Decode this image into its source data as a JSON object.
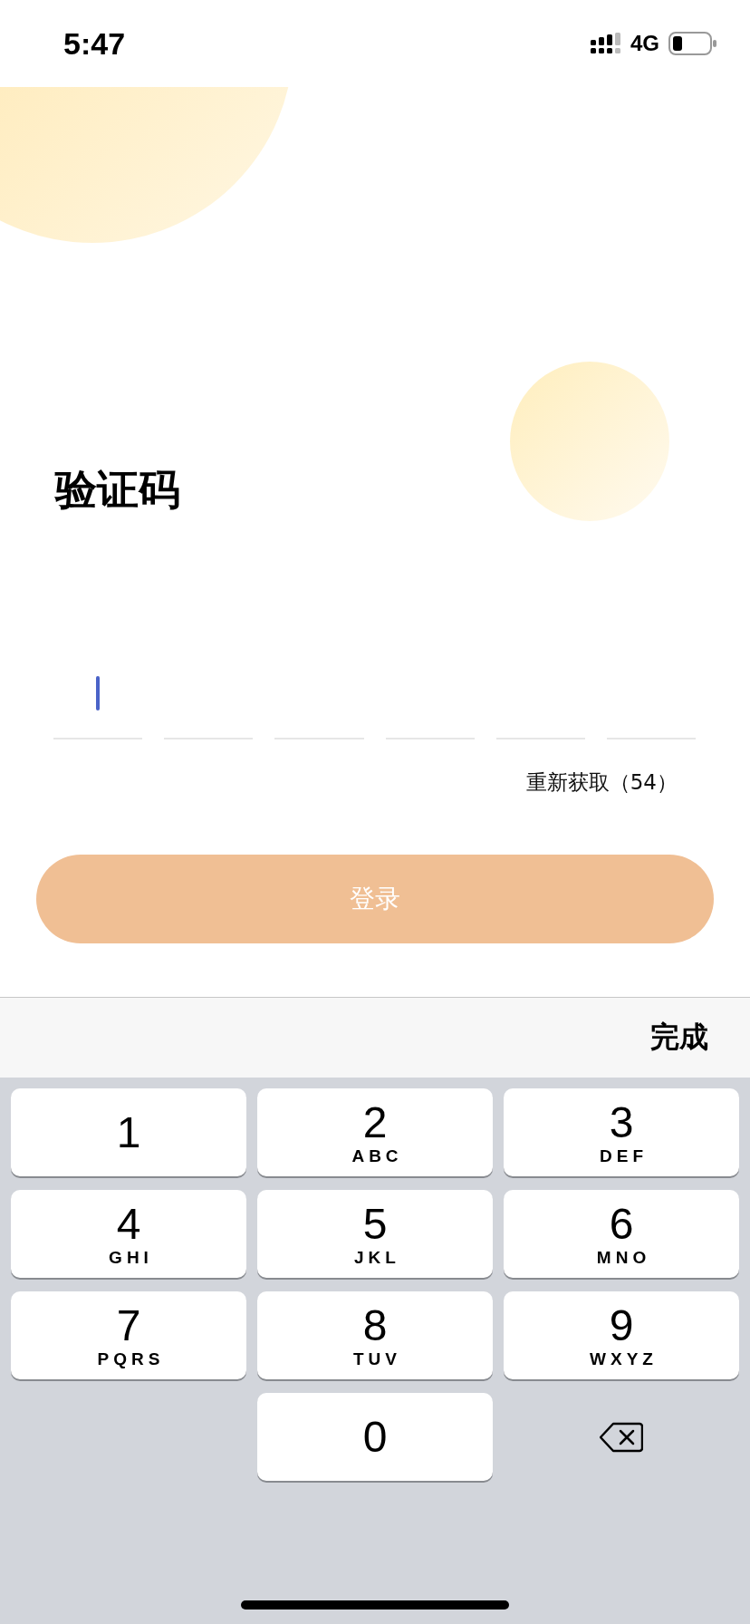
{
  "status_bar": {
    "time": "5:47",
    "network": "4G"
  },
  "title": "验证码",
  "code_boxes": [
    {
      "focused": true
    },
    {
      "focused": false
    },
    {
      "focused": false
    },
    {
      "focused": false
    },
    {
      "focused": false
    },
    {
      "focused": false
    }
  ],
  "resend": "重新获取（54）",
  "login_button": {
    "label": "登录",
    "disabled": true
  },
  "keyboard_toolbar": {
    "done": "完成"
  },
  "keys": [
    {
      "kind": "digit",
      "digit": "1"
    },
    {
      "kind": "digit",
      "digit": "2",
      "letters": "ABC"
    },
    {
      "kind": "digit",
      "digit": "3",
      "letters": "DEF"
    },
    {
      "kind": "digit",
      "digit": "4",
      "letters": "GHI"
    },
    {
      "kind": "digit",
      "digit": "5",
      "letters": "JKL"
    },
    {
      "kind": "digit",
      "digit": "6",
      "letters": "MNO"
    },
    {
      "kind": "digit",
      "digit": "7",
      "letters": "PQRS"
    },
    {
      "kind": "digit",
      "digit": "8",
      "letters": "TUV"
    },
    {
      "kind": "digit",
      "digit": "9",
      "letters": "WXYZ"
    },
    {
      "kind": "blank"
    },
    {
      "kind": "digit",
      "digit": "0"
    },
    {
      "kind": "delete"
    }
  ]
}
